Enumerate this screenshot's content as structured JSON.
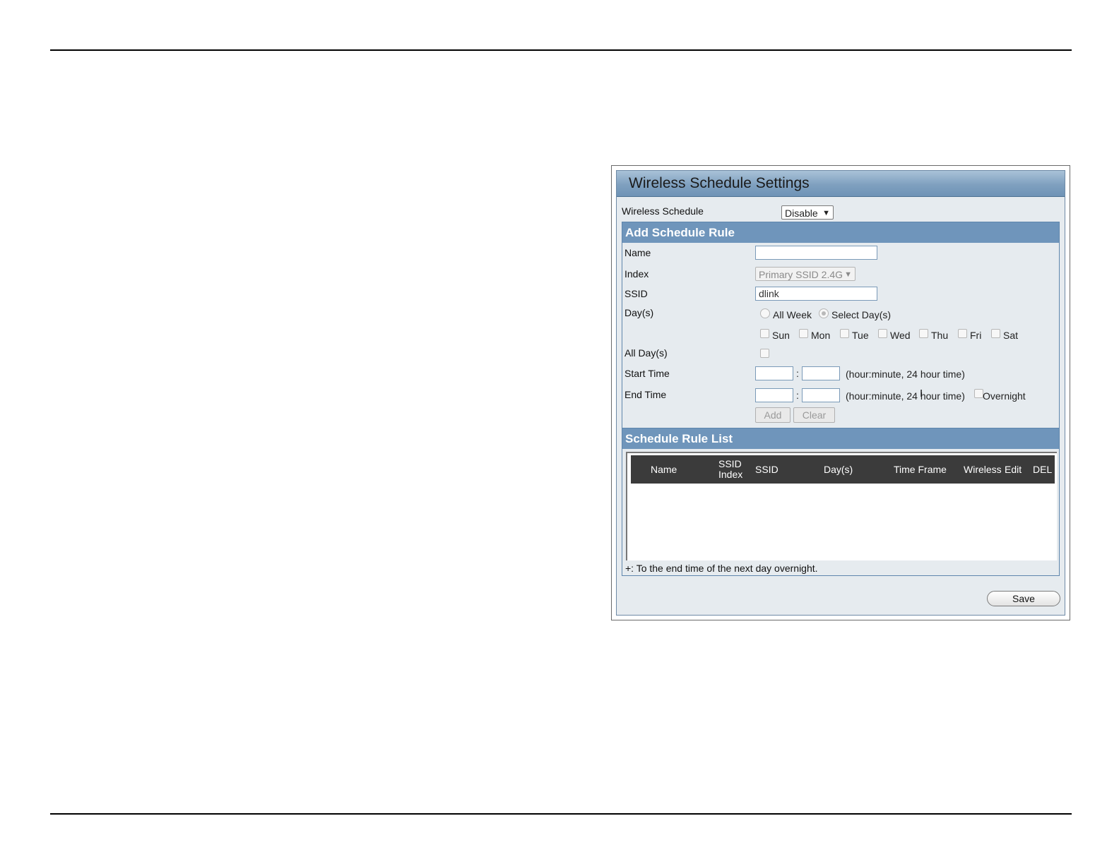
{
  "panel": {
    "title": "Wireless Schedule Settings",
    "wireless_schedule_label": "Wireless Schedule",
    "wireless_schedule_value": "Disable"
  },
  "add_rule": {
    "header": "Add Schedule Rule",
    "name_label": "Name",
    "name_value": "",
    "index_label": "Index",
    "index_value": "Primary SSID 2.4G",
    "ssid_label": "SSID",
    "ssid_value": "dlink",
    "days_label": "Day(s)",
    "all_week_label": "All Week",
    "select_days_label": "Select Day(s)",
    "days": [
      "Sun",
      "Mon",
      "Tue",
      "Wed",
      "Thu",
      "Fri",
      "Sat"
    ],
    "all_days_label": "All Day(s)",
    "start_time_label": "Start Time",
    "end_time_label": "End Time",
    "time_separator": ":",
    "time_hint": "(hour:minute, 24 hour time)",
    "overnight_label": "Overnight",
    "add_button": "Add",
    "clear_button": "Clear"
  },
  "rule_list": {
    "header": "Schedule Rule List",
    "columns": [
      "Name",
      "SSID Index",
      "SSID",
      "Day(s)",
      "Time Frame",
      "Wireless",
      "Edit",
      "DEL"
    ],
    "footnote": "+: To the end time of the next day overnight."
  },
  "save_button": "Save"
}
